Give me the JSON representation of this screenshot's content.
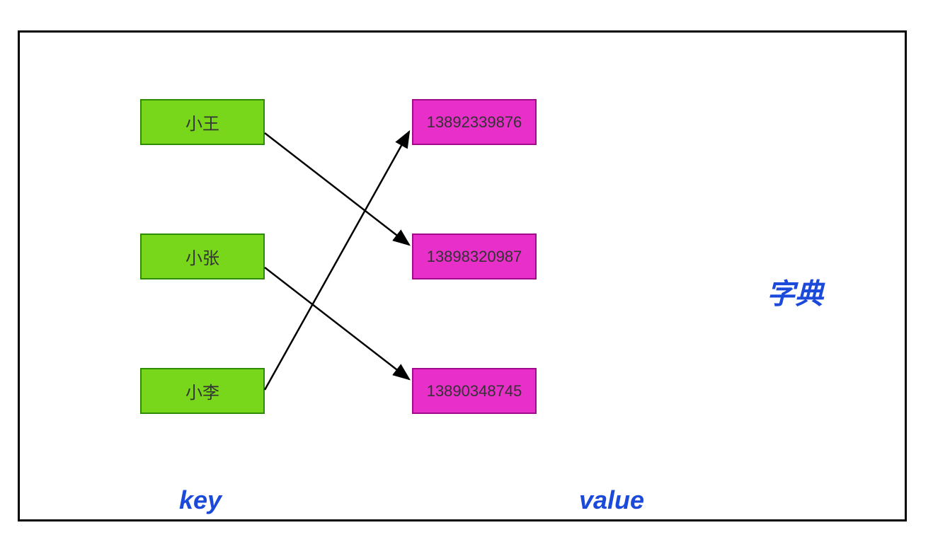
{
  "diagram": {
    "keys": [
      {
        "label": "小王"
      },
      {
        "label": "小张"
      },
      {
        "label": "小李"
      }
    ],
    "values": [
      {
        "label": "13892339876"
      },
      {
        "label": "13898320987"
      },
      {
        "label": "13890348745"
      }
    ],
    "labels": {
      "key": "key",
      "value": "value",
      "title": "字典"
    }
  }
}
